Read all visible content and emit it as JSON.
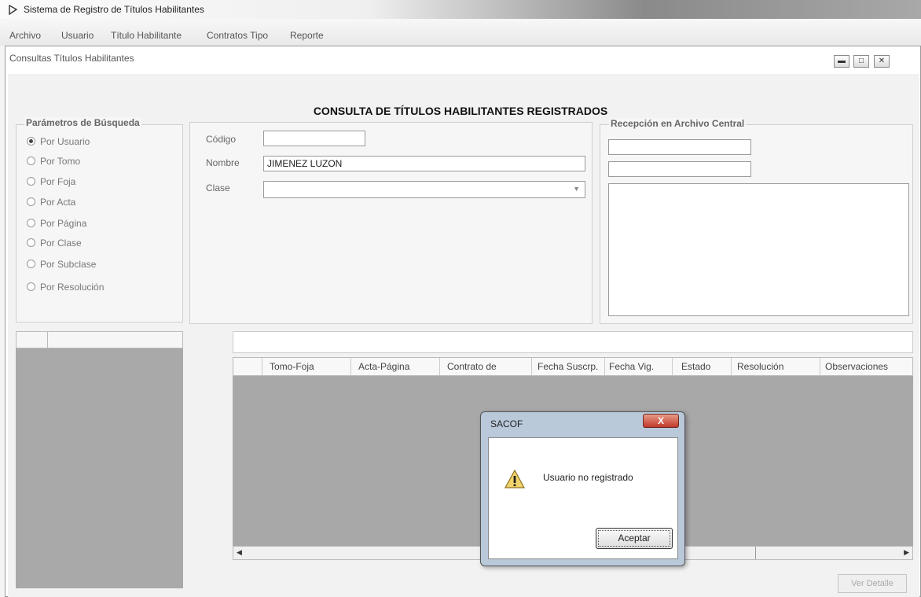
{
  "app": {
    "title": "Sistema de Registro de Títulos Habilitantes",
    "icon": "app-icon"
  },
  "menu": [
    "Archivo",
    "Usuario",
    "Título Habilitante",
    "Contratos Tipo",
    "Reporte"
  ],
  "mdi_window": {
    "title": "Consultas Títulos Habilitantes",
    "controls": [
      "minimize",
      "restore",
      "close"
    ]
  },
  "heading": "CONSULTA DE TÍTULOS HABILITANTES REGISTRADOS",
  "search_params": {
    "label": "Parámetros de Búsqueda",
    "options": [
      "Por Usuario",
      "Por Tomo",
      "Por Foja",
      "Por Acta",
      "Por Página",
      "Por Clase",
      "Por Subclase",
      "Por Resolución"
    ],
    "selected": "Por Usuario"
  },
  "fields": {
    "codigo_label": "Código",
    "codigo_value": "",
    "nombre_label": "Nombre",
    "nombre_value": "JIMENEZ LUZON",
    "clase_label": "Clase",
    "clase_value": ""
  },
  "reception": {
    "label": "Recepción en Archivo Central"
  },
  "grid": {
    "columns": [
      "Tomo-Foja",
      "Acta-Página",
      "Contrato de",
      "Fecha Suscrp.",
      "Fecha Vig.",
      "Estado",
      "Resolución",
      "Observaciones"
    ],
    "rows": []
  },
  "dialog": {
    "title": "SACOF",
    "message": "Usuario no registrado",
    "button": "Aceptar",
    "close": "X"
  },
  "detail_button": "Ver Detalle",
  "colors": {
    "grid_bg": "#a8a8a8",
    "dialog_frame": "#b9c9da",
    "close_red": "#c0392b"
  }
}
